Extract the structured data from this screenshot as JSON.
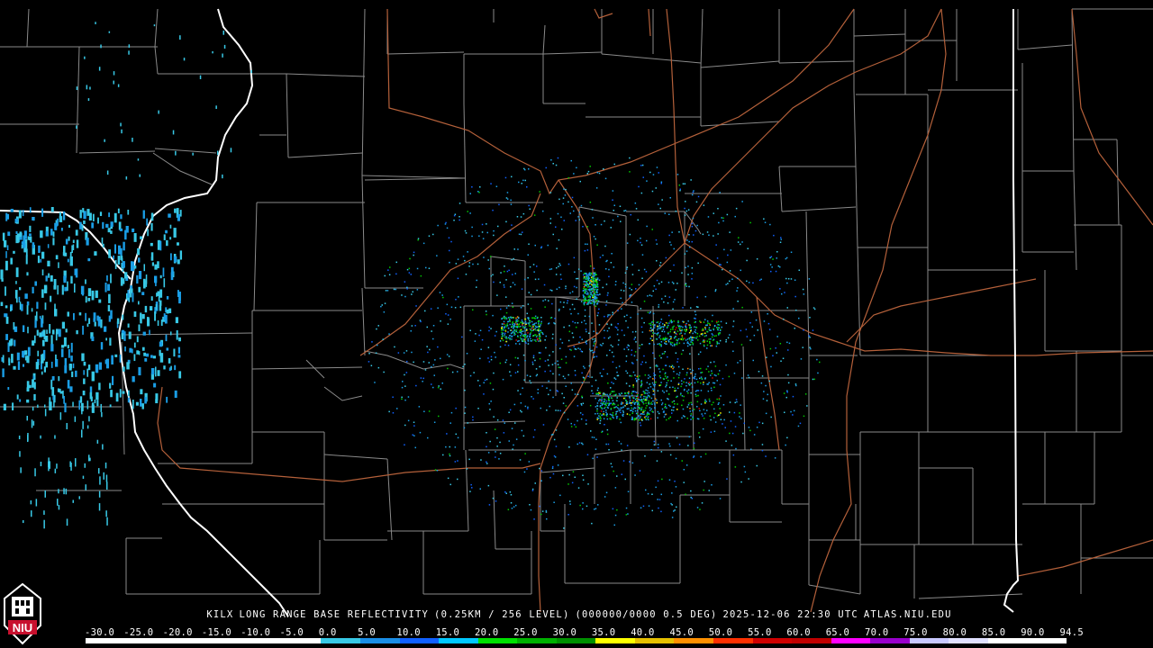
{
  "product": {
    "station": "KILX",
    "product_name": "LONG RANGE BASE REFLECTIVITY",
    "resolution": "(0.25KM / 256 LEVEL)",
    "volume": "(000000/0000 0.5 DEG)",
    "timestamp": "2025-12-06 22:30 UTC",
    "source": "ATLAS.NIU.EDU"
  },
  "logo": {
    "text": "NIU",
    "name": "niu-logo"
  },
  "colors": {
    "background": "#000000",
    "county_lines": "#8a8a8a",
    "state_lines": "#ffffff",
    "roads": "#b4603a"
  },
  "scale": {
    "unit_values": [
      "-30.0",
      "-25.0",
      "-20.0",
      "-15.0",
      "-10.0",
      "-5.0",
      "0.0",
      "5.0",
      "10.0",
      "15.0",
      "20.0",
      "25.0",
      "30.0",
      "35.0",
      "40.0",
      "45.0",
      "50.0",
      "55.0",
      "60.0",
      "65.0",
      "70.0",
      "75.0",
      "80.0",
      "85.0",
      "90.0",
      "94.5"
    ],
    "bar_colors": [
      "#ffffff",
      "#ffffff",
      "#ffffff",
      "#ffffff",
      "#ffffff",
      "#ffffff",
      "#38c9e6",
      "#1a8ee6",
      "#1060ff",
      "#00c8ff",
      "#00e000",
      "#00b000",
      "#009000",
      "#ffff00",
      "#e6c000",
      "#ff9000",
      "#ff3000",
      "#d00000",
      "#c00000",
      "#ff00ff",
      "#9900cc",
      "#c8c8ff",
      "#e0e0ff",
      "#ffffff",
      "#ffffff"
    ]
  }
}
